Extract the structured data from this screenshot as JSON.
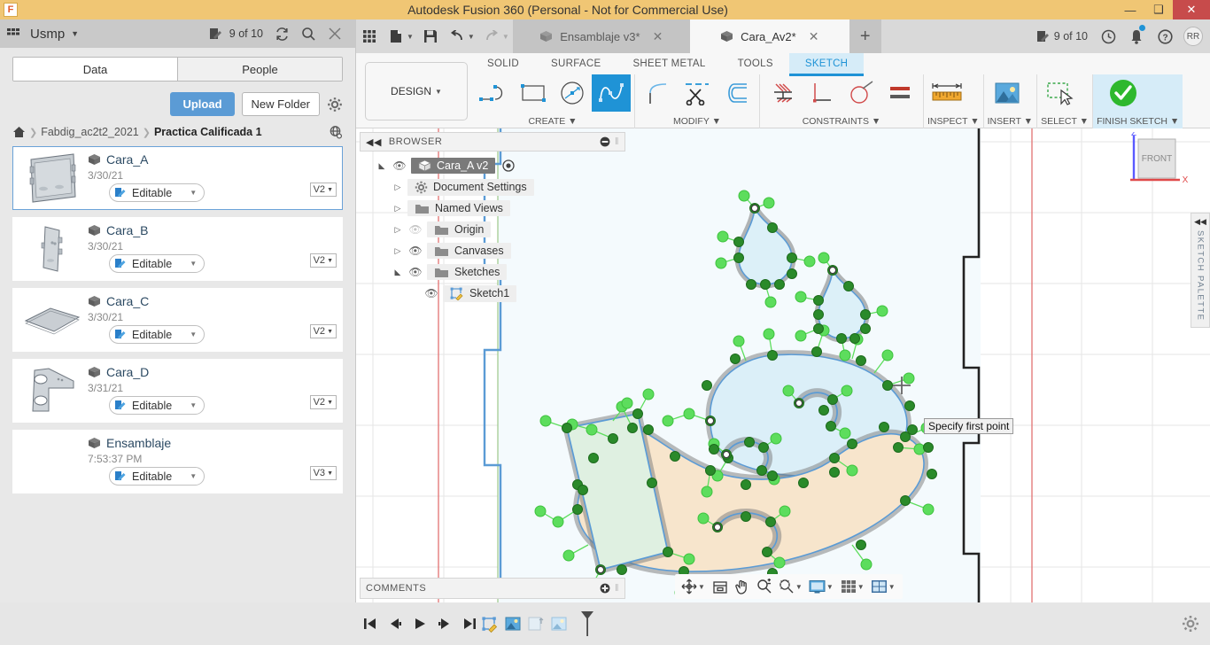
{
  "titlebar": {
    "title": "Autodesk Fusion 360 (Personal - Not for Commercial Use)",
    "app_icon": "fusion-logo-icon",
    "minimize": "minimize-icon",
    "maximize": "restore-icon",
    "close": "close-icon"
  },
  "data_panel": {
    "hub_name": "Usmp",
    "hub_icon": "people-icon",
    "notifications_count": "9 of 10",
    "notifications_icon": "edit-doc-icon",
    "refresh_icon": "refresh-icon",
    "search_icon": "search-icon",
    "close_icon": "close-icon",
    "tabs": [
      {
        "label": "Data",
        "active": true
      },
      {
        "label": "People",
        "active": false
      }
    ],
    "upload_label": "Upload",
    "new_folder_label": "New Folder",
    "settings_icon": "gear-icon",
    "breadcrumb": {
      "home_icon": "home-icon",
      "items": [
        "Fabdig_ac2t2_2021",
        "Practica Calificada 1"
      ],
      "globe_icon": "globe-share-icon"
    },
    "files": [
      {
        "name": "Cara_A",
        "date": "3/30/21",
        "status": "Editable",
        "version": "V2",
        "selected": true
      },
      {
        "name": "Cara_B",
        "date": "3/30/21",
        "status": "Editable",
        "version": "V2",
        "selected": false
      },
      {
        "name": "Cara_C",
        "date": "3/30/21",
        "status": "Editable",
        "version": "V2",
        "selected": false
      },
      {
        "name": "Cara_D",
        "date": "3/31/21",
        "status": "Editable",
        "version": "V2",
        "selected": false
      },
      {
        "name": "Ensamblaje",
        "date": "7:53:37 PM",
        "status": "Editable",
        "version": "V3",
        "selected": false
      }
    ]
  },
  "app_toolbar": {
    "grid_icon": "app-grid-icon",
    "new_icon": "new-file-icon",
    "save_icon": "save-icon",
    "undo_icon": "undo-icon",
    "redo_icon": "redo-icon",
    "doc_tabs": [
      {
        "label": "Ensamblaje v3*",
        "active": false
      },
      {
        "label": "Cara_Av2*",
        "active": true
      }
    ],
    "new_tab_icon": "plus-icon",
    "counter": "9 of 10",
    "counter_icon": "edit-doc-icon",
    "history_icon": "clock-icon",
    "bell_icon": "notification-bell-icon",
    "help_icon": "help-icon",
    "avatar_initials": "RR"
  },
  "ribbon": {
    "workspace_label": "DESIGN",
    "tabs": [
      {
        "label": "SOLID",
        "active": false
      },
      {
        "label": "SURFACE",
        "active": false
      },
      {
        "label": "SHEET METAL",
        "active": false
      },
      {
        "label": "TOOLS",
        "active": false
      },
      {
        "label": "SKETCH",
        "active": true
      }
    ],
    "groups": [
      {
        "label": "CREATE",
        "icons": [
          {
            "name": "line-icon",
            "selected": false
          },
          {
            "name": "rectangle-icon",
            "selected": false
          },
          {
            "name": "circle-icon",
            "selected": false
          },
          {
            "name": "spline-fit-point-icon",
            "selected": true
          }
        ]
      },
      {
        "label": "MODIFY",
        "icons": [
          {
            "name": "fillet-icon",
            "selected": false
          },
          {
            "name": "trim-scissors-icon",
            "selected": false
          },
          {
            "name": "offset-icon",
            "selected": false
          }
        ]
      },
      {
        "label": "CONSTRAINTS",
        "icons": [
          {
            "name": "fix-unfix-icon",
            "selected": false
          },
          {
            "name": "perpendicular-icon",
            "selected": false
          },
          {
            "name": "tangent-icon",
            "selected": false
          },
          {
            "name": "equal-icon",
            "selected": false
          }
        ]
      },
      {
        "label": "INSPECT",
        "icons": [
          {
            "name": "measure-ruler-icon",
            "selected": false
          }
        ]
      },
      {
        "label": "INSERT",
        "icons": [
          {
            "name": "insert-image-canvas-icon",
            "selected": false
          }
        ]
      },
      {
        "label": "SELECT",
        "icons": [
          {
            "name": "select-window-cursor-icon",
            "selected": false
          }
        ]
      },
      {
        "label": "FINISH SKETCH",
        "highlight": true,
        "icons": [
          {
            "name": "finish-sketch-check-icon",
            "selected": false
          }
        ]
      }
    ]
  },
  "browser": {
    "header": "BROWSER",
    "collapse_icon": "collapse-left-icon",
    "minus_icon": "minus-circle-icon",
    "tree": [
      {
        "label": "Cara_A v2",
        "depth": 0,
        "expander": "expanded",
        "eye": true,
        "icon": "component-icon",
        "extra": "activate-radio-icon",
        "selected": true
      },
      {
        "label": "Document Settings",
        "depth": 1,
        "expander": "collapsed",
        "eye": false,
        "icon": "gear-icon",
        "selected": false
      },
      {
        "label": "Named Views",
        "depth": 1,
        "expander": "collapsed",
        "eye": false,
        "icon": "folder-icon",
        "selected": false
      },
      {
        "label": "Origin",
        "depth": 2,
        "expander": "collapsed",
        "eye": true,
        "eye_off": true,
        "icon": "folder-icon",
        "selected": false
      },
      {
        "label": "Canvases",
        "depth": 2,
        "expander": "collapsed",
        "eye": true,
        "icon": "folder-icon",
        "selected": false
      },
      {
        "label": "Sketches",
        "depth": 2,
        "expander": "expanded",
        "eye": true,
        "icon": "folder-icon",
        "selected": false
      },
      {
        "label": "Sketch1",
        "depth": 3,
        "expander": "none",
        "eye": true,
        "icon": "sketch-icon",
        "selected": false
      }
    ]
  },
  "comments": {
    "label": "COMMENTS",
    "add_icon": "add-comment-icon"
  },
  "navbar": {
    "icons": [
      "orbit-icon",
      "look-at-icon",
      "pan-icon",
      "zoom-icon",
      "fit-icon",
      "display-settings-icon",
      "grid-snaps-icon",
      "viewports-icon"
    ]
  },
  "viewcube": {
    "face_label": "FRONT",
    "axis_z": "Z",
    "axis_x": "X"
  },
  "sketch_palette": {
    "label": "SKETCH PALETTE",
    "collapse_icon": "collapse-right-icon"
  },
  "canvas": {
    "tooltip": "Specify first point",
    "cursor_icon": "crosshair-cursor-icon",
    "colors": {
      "sketch_blue": "#5b9bd5",
      "point_green": "#3ec23e",
      "fill_lightblue": "#d6ecf5",
      "fill_peach": "#f7e2c3",
      "fill_green": "#d6ecd9",
      "x_axis_red": "#e06666",
      "y_axis_green": "#93c47d",
      "profile_black": "#222222"
    }
  },
  "bottom_bar": {
    "playback": [
      "skip-to-start-icon",
      "step-back-icon",
      "play-icon",
      "step-forward-icon",
      "skip-to-end-icon"
    ],
    "timeline_items": [
      "sketch-timeline-icon",
      "canvas-timeline-icon",
      "canvas-timeline-disabled-icon",
      "canvas-timeline-icon-2"
    ],
    "marker_icon": "timeline-marker-icon",
    "settings_icon": "gear-icon"
  }
}
